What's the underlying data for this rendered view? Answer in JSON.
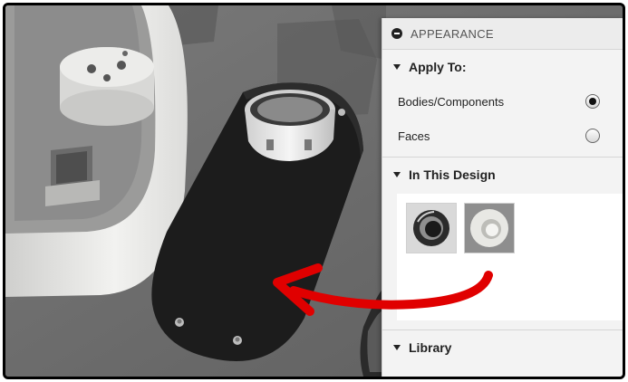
{
  "panel": {
    "title": "APPEARANCE",
    "apply_to": {
      "label": "Apply To:",
      "options": [
        {
          "label": "Bodies/Components",
          "selected": true
        },
        {
          "label": "Faces",
          "selected": false
        }
      ]
    },
    "in_this_design": {
      "label": "In This Design",
      "swatches": [
        {
          "name": "dark-glossy-material",
          "color": "#2b2b2b"
        },
        {
          "name": "white-plastic-material",
          "color": "#e8e8e4"
        }
      ]
    },
    "library": {
      "label": "Library"
    }
  },
  "colors": {
    "viewport_bg": "#6c6c6c",
    "annotation_arrow": "#e00000",
    "black_plate": "#1c1c1c",
    "white_body": "#e9e9e7"
  }
}
